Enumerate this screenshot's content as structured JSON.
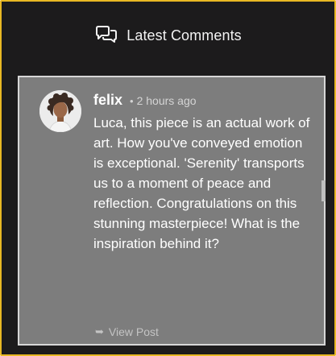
{
  "header": {
    "title": "Latest Comments",
    "icon": "comments-icon"
  },
  "comment": {
    "author": "felix",
    "separator": "•",
    "time": "2 hours ago",
    "text": "Luca, this piece is an actual work of art. How you've conveyed emotion is exceptional. 'Serenity' transports us to a moment of peace and reflection. Congratulations on this stunning masterpiece! What is the inspiration behind it?",
    "view_post_arrow": "➥",
    "view_post_label": "View Post"
  },
  "colors": {
    "panel_bg": "#1c1b1c",
    "panel_border": "#e8b824",
    "card_bg": "#7d7d7d",
    "card_border": "#d7d7d7"
  }
}
